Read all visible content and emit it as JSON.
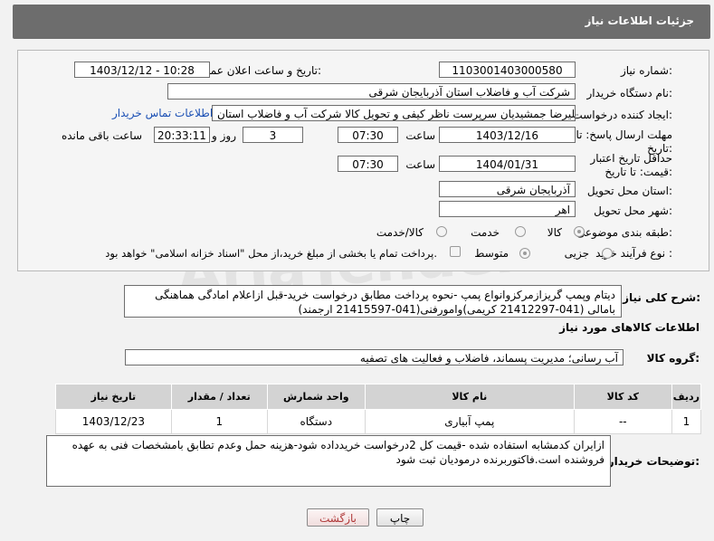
{
  "header": {
    "title": "جزئیات اطلاعات نیاز"
  },
  "form": {
    "need_number_label": "شماره نیاز:",
    "need_number": "1103001403000580",
    "announce_label": "تاریخ و ساعت اعلان عمومی:",
    "announce_value": "1403/12/12 - 10:28",
    "buyer_org_label": "نام دستگاه خریدار:",
    "buyer_org": "شرکت آب و فاضلاب استان آذربایجان شرقی",
    "creator_label": "ایجاد کننده درخواست:",
    "creator": "علیرضا جمشیدیان سرپرست ناظر کیفی و تحویل کالا شرکت آب و فاضلاب استان",
    "contact_link": "اطلاعات تماس خریدار",
    "reply_deadline_label": "مهلت ارسال پاسخ: تا تاریخ:",
    "reply_date": "1403/12/16",
    "time_label": "ساعت",
    "reply_time": "07:30",
    "days_value": "3",
    "days_label": "روز و",
    "remaining_time": "20:33:11",
    "remaining_label": "ساعت باقی مانده",
    "price_validity_label": "حداقل تاریخ اعتبار قیمت: تا تاریخ:",
    "price_date": "1404/01/31",
    "price_time": "07:30",
    "province_label": "استان محل تحویل:",
    "province": "آذربایجان شرقی",
    "city_label": "شهر محل تحویل:",
    "city": "اهر",
    "category_label": "طبقه بندی موضوعی:",
    "category_options": [
      "کالا",
      "خدمت",
      "کالا/خدمت"
    ],
    "process_label": "نوع فرآیند خرید :",
    "process_options": [
      "جزیی",
      "متوسط"
    ],
    "payment_note": "پرداخت تمام یا بخشی از مبلغ خرید،از محل \"اسناد خزانه اسلامی\" خواهد بود."
  },
  "description": {
    "label": "شرح کلی نیاز:",
    "text": "دیتام وپمپ گریزازمرکزوانواع پمپ -نحوه پرداخت مطابق درخواست خرید-قبل ازاعلام امادگی هماهنگی بامالی (041-21412297 کریمی)وامورفنی(041-21415597 ارجمند)"
  },
  "goods": {
    "section_title": "اطلاعات کالاهای مورد نیاز",
    "group_label": "گروه کالا:",
    "group_value": "آب رسانی؛ مدیریت پسماند، فاضلاب و فعالیت های تصفیه",
    "columns": [
      "ردیف",
      "کد کالا",
      "نام کالا",
      "واحد شمارش",
      "تعداد / مقدار",
      "تاریخ نیاز"
    ],
    "rows": [
      {
        "row": "1",
        "code": "--",
        "name": "پمپ آبیاری",
        "unit": "دستگاه",
        "qty": "1",
        "date": "1403/12/23"
      }
    ]
  },
  "buyer_notes": {
    "label": "توضیحات خریدار:",
    "text": "ازایران کدمشابه استفاده شده -قیمت کل 2درخواست خریدداده شود-هزینه حمل وعدم تطابق بامشخصات فنی به عهده فروشنده است.فاکتوربرنده درمودیان ثبت شود"
  },
  "buttons": {
    "print": "چاپ",
    "back": "بازگشت"
  },
  "watermark": "AriaTender.neT"
}
